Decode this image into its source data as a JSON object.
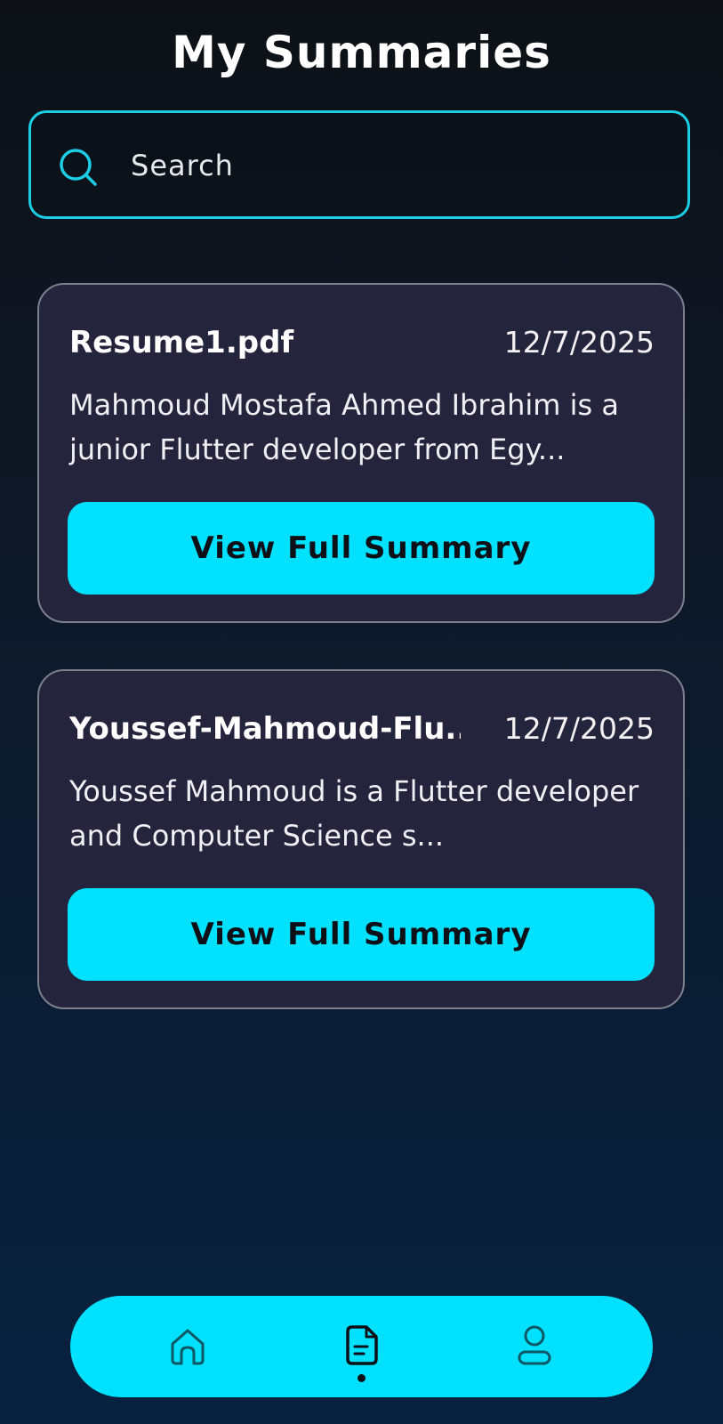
{
  "header": {
    "title": "My Summaries"
  },
  "search": {
    "placeholder": "Search",
    "value": ""
  },
  "summaries": [
    {
      "file_name": "Resume1.pdf",
      "date": "12/7/2025",
      "description": "Mahmoud Mostafa Ahmed Ibrahim is a junior Flutter developer from Egy...",
      "button_label": "View Full Summary"
    },
    {
      "file_name": "Youssef-Mahmoud-Flu...",
      "date": "12/7/2025",
      "description": "Youssef Mahmoud is a Flutter developer and Computer Science s...",
      "button_label": "View Full Summary"
    }
  ],
  "bottom_nav": {
    "items": [
      {
        "icon": "home-icon",
        "active": false
      },
      {
        "icon": "summaries-icon",
        "active": true
      },
      {
        "icon": "profile-icon",
        "active": false
      }
    ]
  },
  "colors": {
    "accent": "#00e0ff",
    "search_border": "#1ccde6",
    "card_background": "#25243d",
    "card_border": "#7c7f8c",
    "nav_icon": "#0e5866",
    "nav_icon_active": "#0d1117"
  }
}
